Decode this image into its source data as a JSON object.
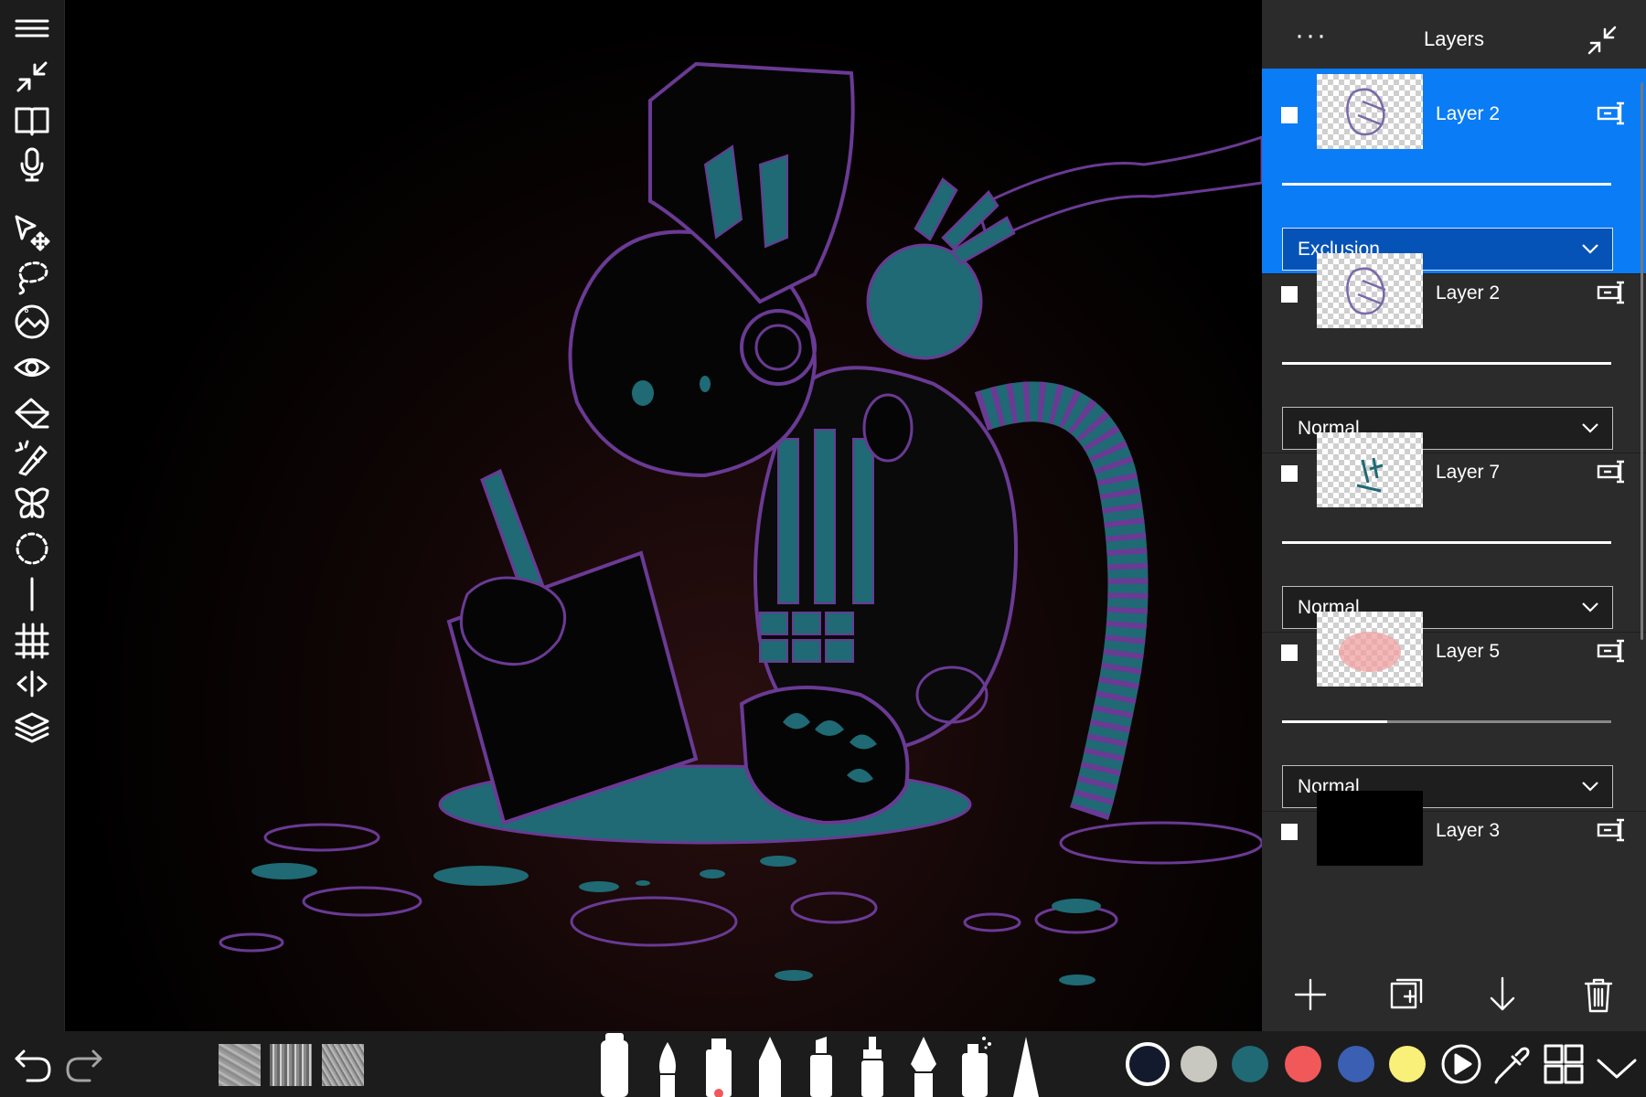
{
  "layers_panel": {
    "title": "Layers",
    "more_label": "···",
    "items": [
      {
        "name": "Layer 2",
        "blend_mode": "Exclusion",
        "selected": true,
        "opacity": 1.0
      },
      {
        "name": "Layer 2",
        "blend_mode": "Normal",
        "selected": false,
        "opacity": 1.0
      },
      {
        "name": "Layer 7",
        "blend_mode": "Normal",
        "selected": false,
        "opacity": 1.0
      },
      {
        "name": "Layer 5",
        "blend_mode": "Normal",
        "selected": false,
        "opacity": 0.32
      },
      {
        "name": "Layer 3",
        "selected": false
      }
    ]
  },
  "left_tools": [
    "menu-icon",
    "collapse-icon",
    "gallery-book-icon",
    "microphone-icon",
    "move-transform-icon",
    "lasso-selection-icon",
    "image-adjust-icon",
    "visibility-eye-icon",
    "fill-bucket-icon",
    "magic-wand-icon",
    "symmetry-butterfly-icon",
    "ellipse-guide-icon",
    "line-ruler-icon",
    "perspective-grid-icon",
    "flip-icon",
    "layers-icon"
  ],
  "bottom_toolbar": {
    "brushes": [
      "paint-tube-brush",
      "round-brush",
      "marker-brush",
      "pencil-brush",
      "highlighter-brush",
      "felt-pen-brush",
      "ink-pen-brush",
      "spray-brush",
      "airbrush-cone-brush"
    ],
    "colors": {
      "active": "#141a2e",
      "swatches": [
        "#c8c8c0",
        "#1f6a74",
        "#f0585a",
        "#3a5fb3",
        "#f9f07a"
      ]
    }
  },
  "colors": {
    "accent": "#0a7cf5",
    "panel": "#2b2b2b",
    "toolbar": "#1c1c1c",
    "line_purple": "#6a3a94",
    "fill_teal": "#1f6a74"
  }
}
